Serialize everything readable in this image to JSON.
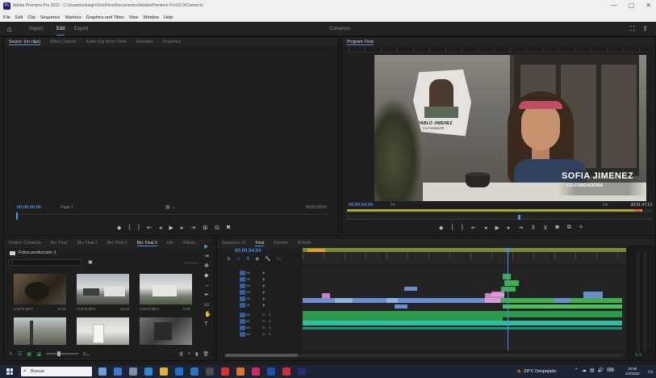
{
  "window": {
    "title": "Adobe Premiere Pro 2022 - C:\\Usuarios\\luegin\\OneDrive\\Documentos\\Adobe\\Premiere Pro\\22.0\\Comercio",
    "controls": [
      "—",
      "▢",
      "✕"
    ]
  },
  "menu": [
    "File",
    "Edit",
    "Clip",
    "Sequence",
    "Markers",
    "Graphics and Titles",
    "View",
    "Window",
    "Help"
  ],
  "workspace": {
    "tabs": [
      "Import",
      "Edit",
      "Export"
    ],
    "active": "Edit",
    "project_name": "Comercio"
  },
  "source_monitor": {
    "tabs": [
      "Source: (no clips)",
      "Effect Controls",
      "Audio Clip Mixer: Final",
      "Metadata",
      "Properties"
    ],
    "timecode": "00;00;00;00",
    "page": "Page 1",
    "duration": "00;00;00;00"
  },
  "program_monitor": {
    "tab": "Program: Final",
    "timecode": "00;00;54;04",
    "fit": "Fit",
    "fraction": "1/4",
    "duration": "00;01;47;13",
    "overlay": {
      "inset_name": "PABLO JIMENEZ",
      "inset_role": "CO-FUNDADOR",
      "name": "SOFIA JIMENEZ",
      "role": "CO-FUNDADORA"
    }
  },
  "project": {
    "tabs": [
      "Project: Comercio",
      "Bin: Final",
      "Bin: Final 1",
      "Bin: Final 2",
      "Bin: Final 3",
      "Info",
      "Effects"
    ],
    "active_tab": "Bin: Final 3",
    "bin_name": "Fotos producción 1",
    "search_placeholder": "",
    "item_count": "32 items",
    "clips": [
      {
        "name": "C0274.MP4",
        "duration": "18;11"
      },
      {
        "name": "C0275.MP4",
        "duration": "10;00"
      },
      {
        "name": "C0276.MP4",
        "duration": "5;26"
      },
      {
        "name": "",
        "duration": ""
      },
      {
        "name": "",
        "duration": ""
      },
      {
        "name": "",
        "duration": ""
      }
    ]
  },
  "timeline": {
    "tabs": [
      "Sequence 01",
      "Final",
      "Preview",
      "B-Rolls"
    ],
    "active_tab": "Final",
    "timecode": "00;00;54;04",
    "tracks": [
      "V6",
      "V5",
      "V4",
      "V3",
      "V2",
      "V1",
      "A1",
      "A2",
      "A3",
      "A4"
    ],
    "in_marker_label": "00;00;54;04"
  },
  "taskbar": {
    "search_placeholder": "Buscar",
    "weather": "29°C Despejado",
    "time": "22:56",
    "date": "1/4/2022"
  },
  "colors": {
    "accent_blue": "#4a8ee8",
    "workarea_green": "#7b8a3a",
    "clip_blue": "#6a8fd0",
    "clip_pink": "#d07ad0",
    "clip_green": "#3fae4f",
    "audio_teal": "#2fbf9f"
  }
}
